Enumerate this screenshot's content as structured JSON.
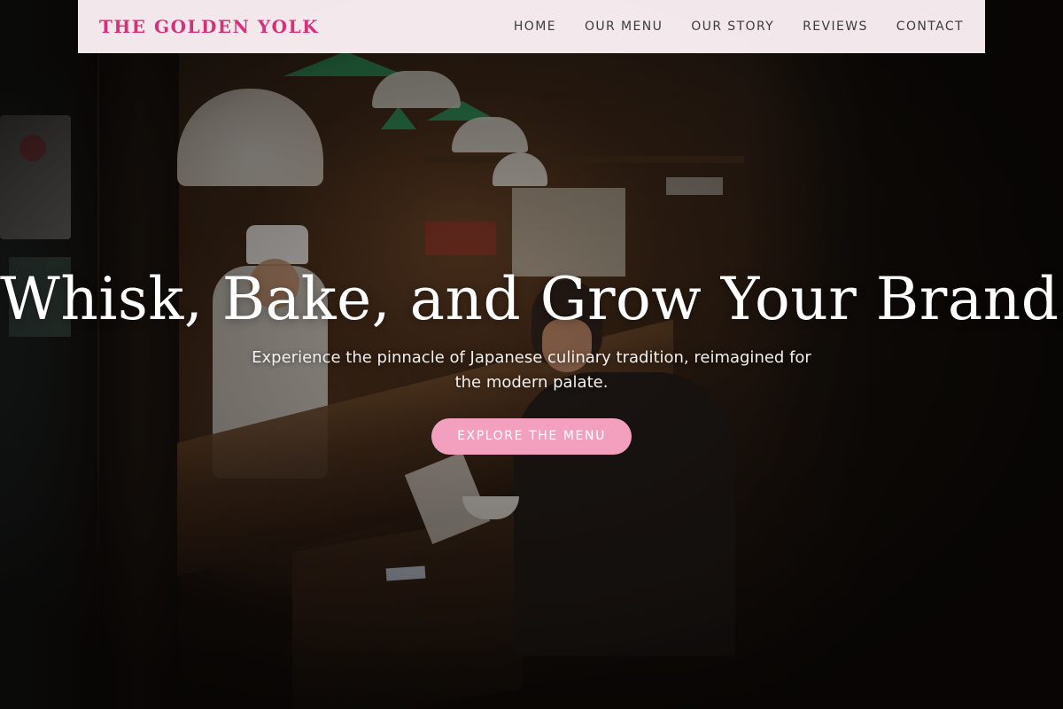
{
  "brand": {
    "name": "THE GOLDEN YOLK",
    "color": "#d6307a"
  },
  "nav": {
    "items": [
      {
        "label": "HOME"
      },
      {
        "label": "OUR MENU"
      },
      {
        "label": "OUR STORY"
      },
      {
        "label": "REVIEWS"
      },
      {
        "label": "CONTACT"
      }
    ]
  },
  "hero": {
    "title": "Whisk, Bake, and Grow Your Brand.",
    "subtitle": "Experience the pinnacle of Japanese culinary tradition, reimagined for the modern palate.",
    "cta_label": "EXPLORE THE MENU",
    "cta_color": "#f3a0bf"
  },
  "header": {
    "background_color": "#fcf1f5"
  }
}
